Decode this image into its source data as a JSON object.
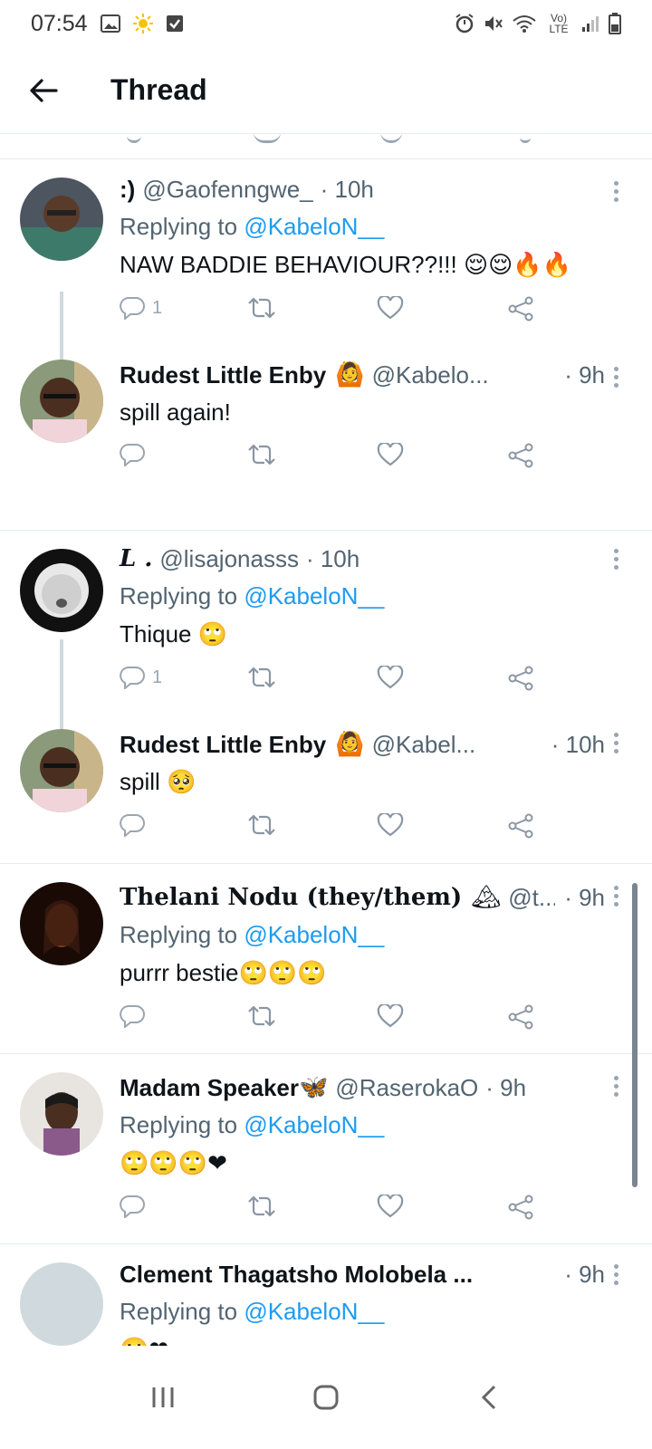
{
  "status_bar": {
    "time": "07:54",
    "network_label": "Vo) LTE"
  },
  "header": {
    "title": "Thread"
  },
  "tweets": [
    {
      "name": ":)",
      "handle": "@Gaofenngwe_",
      "time": "· 10h",
      "replying_prefix": "Replying to",
      "replying_to": "@KabeloN__",
      "text": "NAW BADDIE BEHAVIOUR??!!!",
      "emojis": "😌😌🔥🔥",
      "reply_count": "1",
      "avatar_color": "#3d7a6a"
    },
    {
      "name": "Rudest Little Enby",
      "badge_emoji": "🙆",
      "handle": "@Kabelo...",
      "time": "· 9h",
      "text": "spill again!",
      "reply_count": "",
      "avatar_color": "#5a4a3a"
    },
    {
      "name": "L .",
      "handle": "@lisajonasss",
      "time": "· 10h",
      "replying_prefix": "Replying to",
      "replying_to": "@KabeloN__",
      "text": "Thique",
      "emojis": "🙄",
      "reply_count": "1",
      "avatar_color": "#2a2a2a"
    },
    {
      "name": "Rudest Little Enby",
      "badge_emoji": "🙆",
      "handle": "@Kabel...",
      "time": "· 10h",
      "text": "spill",
      "emojis": "🥺",
      "reply_count": "",
      "avatar_color": "#5a4a3a"
    },
    {
      "name": "Thelani Nodu (they/them)",
      "badge_emoji": "🏔",
      "handle": "@t...",
      "time": "· 9h",
      "replying_prefix": "Replying to",
      "replying_to": "@KabeloN__",
      "text": "purrr bestie",
      "emojis": "🙄🙄🙄",
      "reply_count": "",
      "avatar_color": "#3a1a10"
    },
    {
      "name": "Madam Speaker",
      "badge_emoji": "🦋",
      "handle": "@RaserokaO",
      "time": "· 9h",
      "replying_prefix": "Replying to",
      "replying_to": "@KabeloN__",
      "text": "",
      "emojis": "🙄🙄🙄❤",
      "reply_count": "",
      "avatar_color": "#b0a090"
    },
    {
      "name": "Clement Thagatsho Molobela ...",
      "handle": "",
      "time": "· 9h",
      "replying_prefix": "Replying to",
      "replying_to": "@KabeloN__",
      "text": "",
      "emojis": "🙄❤",
      "reply_count": "",
      "avatar_color": "#cfd9de"
    }
  ],
  "colors": {
    "link": "#1d9bf0",
    "secondary_text": "#536471",
    "action_icon": "#9aa5b1",
    "divider": "#e6ecf0",
    "heart": "#e0245e"
  },
  "icons": {
    "back": "arrow-left-icon",
    "reply": "speech-bubble-icon",
    "retweet": "retweet-icon",
    "like": "heart-icon",
    "share": "share-icon",
    "more": "vertical-dots-icon"
  }
}
